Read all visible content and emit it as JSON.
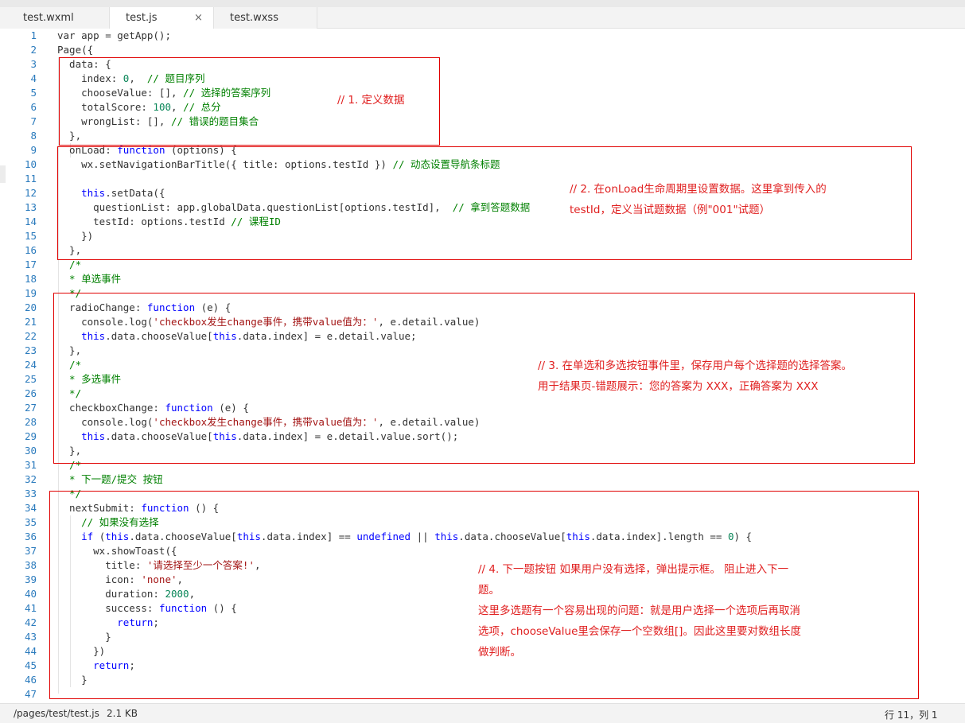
{
  "tabs": [
    {
      "label": "test.wxml",
      "active": false
    },
    {
      "label": "test.js",
      "active": true,
      "close_glyph": "×"
    },
    {
      "label": "test.wxss",
      "active": false
    }
  ],
  "code_lines": [
    [
      {
        "t": "var app = getApp();"
      }
    ],
    [
      {
        "t": "Page({"
      }
    ],
    [
      {
        "t": "  data: {"
      }
    ],
    [
      {
        "t": "    index: "
      },
      {
        "t": "0",
        "c": "num"
      },
      {
        "t": ",  "
      },
      {
        "t": "// 题目序列",
        "c": "com"
      }
    ],
    [
      {
        "t": "    chooseValue: [], "
      },
      {
        "t": "// 选择的答案序列",
        "c": "com"
      }
    ],
    [
      {
        "t": "    totalScore: "
      },
      {
        "t": "100",
        "c": "num"
      },
      {
        "t": ", "
      },
      {
        "t": "// 总分",
        "c": "com"
      }
    ],
    [
      {
        "t": "    wrongList: [], "
      },
      {
        "t": "// 错误的题目集合",
        "c": "com"
      }
    ],
    [
      {
        "t": "  },"
      }
    ],
    [
      {
        "t": "  onLoad: "
      },
      {
        "t": "function",
        "c": "kw"
      },
      {
        "t": " (options) {"
      }
    ],
    [
      {
        "t": "    wx.setNavigationBarTitle({ title: options.testId }) "
      },
      {
        "t": "// 动态设置导航条标题",
        "c": "com"
      }
    ],
    [
      {
        "t": ""
      }
    ],
    [
      {
        "t": "    "
      },
      {
        "t": "this",
        "c": "kw"
      },
      {
        "t": ".setData({"
      }
    ],
    [
      {
        "t": "      questionList: app.globalData.questionList[options.testId],  "
      },
      {
        "t": "// 拿到答题数据",
        "c": "com"
      }
    ],
    [
      {
        "t": "      testId: options.testId "
      },
      {
        "t": "// 课程ID",
        "c": "com"
      }
    ],
    [
      {
        "t": "    })"
      }
    ],
    [
      {
        "t": "  },"
      }
    ],
    [
      {
        "t": "  /*",
        "c": "com"
      }
    ],
    [
      {
        "t": "  * 单选事件",
        "c": "com"
      }
    ],
    [
      {
        "t": "  */",
        "c": "com"
      }
    ],
    [
      {
        "t": "  radioChange: "
      },
      {
        "t": "function",
        "c": "kw"
      },
      {
        "t": " (e) {"
      }
    ],
    [
      {
        "t": "    console.log("
      },
      {
        "t": "'checkbox发生change事件，携带value值为：'",
        "c": "str"
      },
      {
        "t": ", e.detail.value)"
      }
    ],
    [
      {
        "t": "    "
      },
      {
        "t": "this",
        "c": "kw"
      },
      {
        "t": ".data.chooseValue["
      },
      {
        "t": "this",
        "c": "kw"
      },
      {
        "t": ".data.index] = e.detail.value;"
      }
    ],
    [
      {
        "t": "  },"
      }
    ],
    [
      {
        "t": "  /*",
        "c": "com"
      }
    ],
    [
      {
        "t": "  * 多选事件",
        "c": "com"
      }
    ],
    [
      {
        "t": "  */",
        "c": "com"
      }
    ],
    [
      {
        "t": "  checkboxChange: "
      },
      {
        "t": "function",
        "c": "kw"
      },
      {
        "t": " (e) {"
      }
    ],
    [
      {
        "t": "    console.log("
      },
      {
        "t": "'checkbox发生change事件，携带value值为：'",
        "c": "str"
      },
      {
        "t": ", e.detail.value)"
      }
    ],
    [
      {
        "t": "    "
      },
      {
        "t": "this",
        "c": "kw"
      },
      {
        "t": ".data.chooseValue["
      },
      {
        "t": "this",
        "c": "kw"
      },
      {
        "t": ".data.index] = e.detail.value.sort();"
      }
    ],
    [
      {
        "t": "  },"
      }
    ],
    [
      {
        "t": "  /*",
        "c": "com"
      }
    ],
    [
      {
        "t": "  * 下一题/提交 按钮",
        "c": "com"
      }
    ],
    [
      {
        "t": "  */",
        "c": "com"
      }
    ],
    [
      {
        "t": "  nextSubmit: "
      },
      {
        "t": "function",
        "c": "kw"
      },
      {
        "t": " () {"
      }
    ],
    [
      {
        "t": "    "
      },
      {
        "t": "// 如果没有选择",
        "c": "com"
      }
    ],
    [
      {
        "t": "    "
      },
      {
        "t": "if",
        "c": "kw"
      },
      {
        "t": " ("
      },
      {
        "t": "this",
        "c": "kw"
      },
      {
        "t": ".data.chooseValue["
      },
      {
        "t": "this",
        "c": "kw"
      },
      {
        "t": ".data.index] == "
      },
      {
        "t": "undefined",
        "c": "kw"
      },
      {
        "t": " || "
      },
      {
        "t": "this",
        "c": "kw"
      },
      {
        "t": ".data.chooseValue["
      },
      {
        "t": "this",
        "c": "kw"
      },
      {
        "t": ".data.index].length == "
      },
      {
        "t": "0",
        "c": "num"
      },
      {
        "t": ") {"
      }
    ],
    [
      {
        "t": "      wx.showToast({"
      }
    ],
    [
      {
        "t": "        title: "
      },
      {
        "t": "'请选择至少一个答案!'",
        "c": "str"
      },
      {
        "t": ","
      }
    ],
    [
      {
        "t": "        icon: "
      },
      {
        "t": "'none'",
        "c": "str"
      },
      {
        "t": ","
      }
    ],
    [
      {
        "t": "        duration: "
      },
      {
        "t": "2000",
        "c": "num"
      },
      {
        "t": ","
      }
    ],
    [
      {
        "t": "        success: "
      },
      {
        "t": "function",
        "c": "kw"
      },
      {
        "t": " () {"
      }
    ],
    [
      {
        "t": "          "
      },
      {
        "t": "return",
        "c": "kw"
      },
      {
        "t": ";"
      }
    ],
    [
      {
        "t": "        }"
      }
    ],
    [
      {
        "t": "      })"
      }
    ],
    [
      {
        "t": "      "
      },
      {
        "t": "return",
        "c": "kw"
      },
      {
        "t": ";"
      }
    ],
    [
      {
        "t": "    }"
      }
    ],
    [
      {
        "t": ""
      }
    ]
  ],
  "annotations": [
    {
      "id": "anno-1",
      "text": "// 1. 定义数据"
    },
    {
      "id": "anno-2",
      "lines": [
        "// 2. 在onLoad生命周期里设置数据。这里拿到传入的",
        "testId，定义当试题数据（例\"001\"试题）"
      ]
    },
    {
      "id": "anno-3",
      "lines": [
        "// 3. 在单选和多选按钮事件里，保存用户每个选择题的选择答案。",
        "用于结果页-错题展示：您的答案为 XXX，正确答案为 XXX"
      ]
    },
    {
      "id": "anno-4",
      "lines": [
        "// 4. 下一题按钮 如果用户没有选择，弹出提示框。  阻止进入下一",
        "题。",
        "这里多选题有一个容易出现的问题：就是用户选择一个选项后再取消",
        "选项，chooseValue里会保存一个空数组[]。因此这里要对数组长度",
        "做判断。"
      ]
    }
  ],
  "status": {
    "path": "/pages/test/test.js",
    "size": "2.1 KB",
    "cursor": "行 11，列 1"
  },
  "colors": {
    "annotation": "#e00000",
    "keyword": "#0000ff",
    "number": "#098658",
    "string": "#a31515",
    "comment": "#008000",
    "line_number": "#2b7bbd"
  }
}
